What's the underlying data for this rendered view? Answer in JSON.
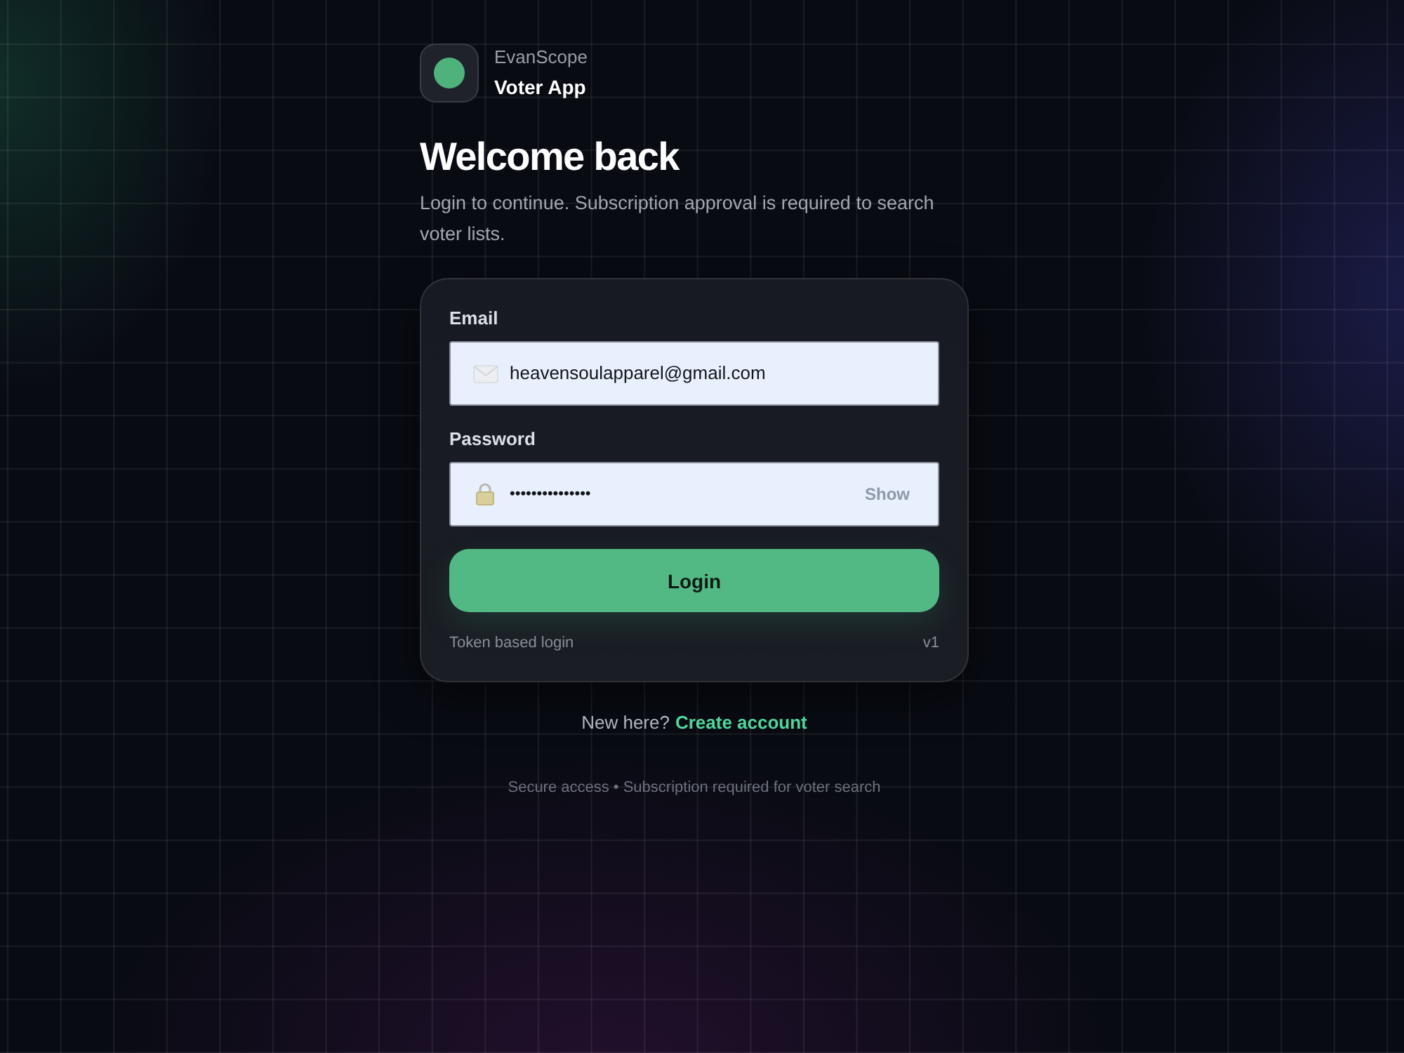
{
  "brand": {
    "company": "EvanScope",
    "app": "Voter App"
  },
  "heading": "Welcome back",
  "subtitle": "Login to continue. Subscription approval is required to search voter lists.",
  "login_form": {
    "fields": [
      {
        "kind": "email",
        "label": "Email",
        "value": "heavensoulapparel@gmail.com"
      },
      {
        "kind": "password",
        "label": "Password",
        "value": "•••••••••••••••",
        "toggle": "Show"
      }
    ],
    "submit": "Login",
    "note": "Token based login",
    "version": "v1"
  },
  "signup": {
    "prompt": "New here?",
    "link": "Create account"
  },
  "footer": "Secure access • Subscription required for voter search"
}
